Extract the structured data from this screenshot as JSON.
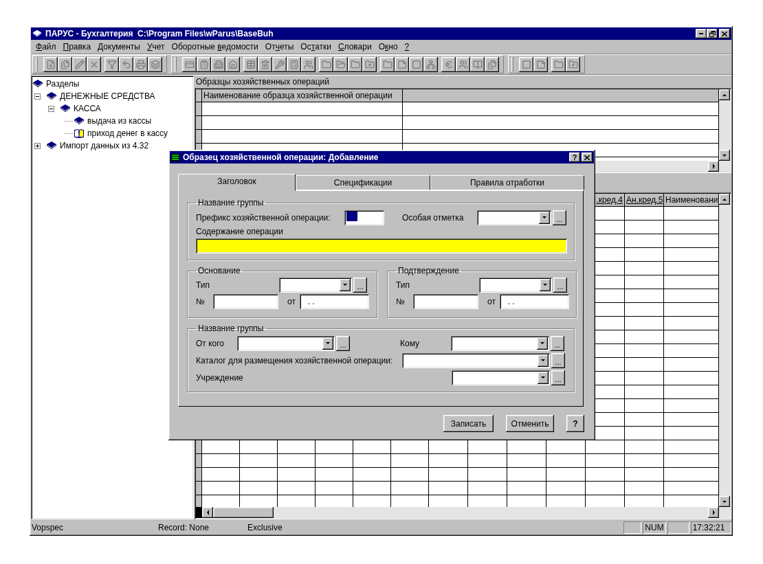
{
  "window": {
    "title": "ПАРУС - Бухгалтерия  C:\\Program Files\\wParus\\BaseBuh"
  },
  "menu": [
    {
      "key": "Ф",
      "post": "айл"
    },
    {
      "key": "П",
      "post": "равка"
    },
    {
      "key": "Д",
      "post": "окументы"
    },
    {
      "key": "У",
      "post": "чет"
    },
    {
      "pre": "Оборотные ",
      "key": "в",
      "post": "едомости"
    },
    {
      "pre": "От",
      "key": "ч",
      "post": "еты"
    },
    {
      "pre": "Ос",
      "key": "т",
      "post": "атки"
    },
    {
      "key": "С",
      "post": "ловари"
    },
    {
      "pre": "О",
      "key": "к",
      "post": "но"
    },
    {
      "key": "?"
    }
  ],
  "tree": {
    "label": "Разделы",
    "children": [
      {
        "label": "ДЕНЕЖНЫЕ СРЕДСТВА",
        "expanded": true,
        "children": [
          {
            "label": "КАССА",
            "expanded": true,
            "children": [
              {
                "label": "выдача из кассы",
                "selected": false
              },
              {
                "label": "приход денег в кассу",
                "selected": true
              }
            ]
          }
        ]
      },
      {
        "label": "Импорт данных из 4.32",
        "expanded": false
      }
    ]
  },
  "templates_panel": {
    "title": "Образцы хозяйственных операций",
    "columns": [
      "Наименование образца хозяйственной операции"
    ]
  },
  "entries_table": {
    "columns": [
      ".кред.4",
      "Ан.кред.5",
      "Наименовани"
    ]
  },
  "dialog": {
    "title": "Образец хозяйственной операции: Добавление",
    "help_button": "?",
    "tabs": [
      {
        "label": "Заголовок",
        "selected": true
      },
      {
        "label": "Спецификации",
        "selected": false
      },
      {
        "label": "Правила отработки",
        "selected": false
      }
    ],
    "header_group": {
      "title": "Название группы",
      "prefix_label": "Префикс хозяйственной операции:",
      "prefix_text_selected": true,
      "mark_label": "Особая отметка",
      "mark_browse": "...",
      "content_label": "Содержание операции",
      "content_highlighted": true
    },
    "documents": [
      {
        "title": "Основание",
        "type_label": "Тип",
        "type_browse": "...",
        "number_label": "№",
        "date_label": "от",
        "date_value": ". ."
      },
      {
        "title": "Подтверждение",
        "type_label": "Тип",
        "type_browse": "...",
        "number_label": "№",
        "date_label": "от",
        "date_value": ". ."
      }
    ],
    "parties_group": {
      "title": "Название группы",
      "from_label": "От кого",
      "from_browse": "...",
      "to_label": "Кому",
      "to_browse": "...",
      "catalog_label": "Каталог для размещения хозяйственной операции:",
      "catalog_browse": "...",
      "institution_label": "Учреждение",
      "institution_browse": "..."
    },
    "buttons": [
      "Записать",
      "Отменить",
      "?"
    ]
  },
  "status_bar": {
    "name": "Vopspec",
    "record": "Record: None",
    "mode": "Exclusive",
    "num": "NUM",
    "time": "17:32:21"
  }
}
